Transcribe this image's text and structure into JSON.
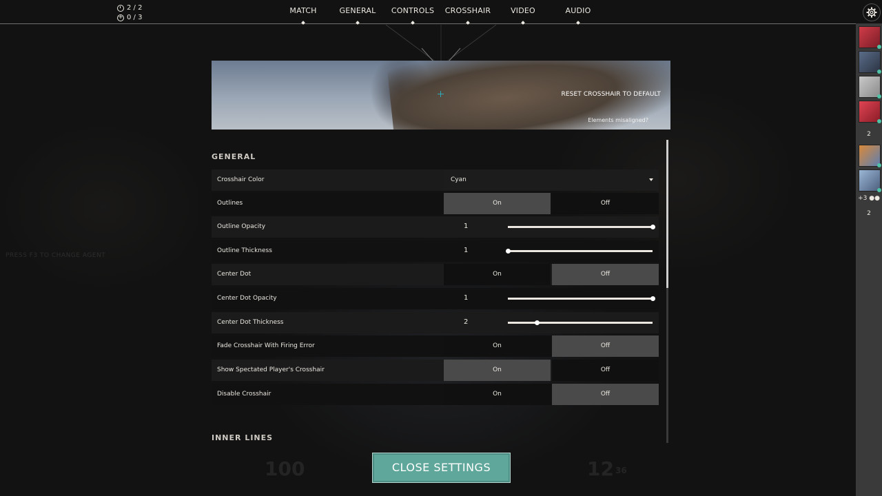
{
  "hud": {
    "rounds": "2 / 2",
    "credits": "0 / 3",
    "health": "100",
    "ammo": "12",
    "reserve": "36",
    "agent_hint": "PRESS F3 TO CHANGE AGENT"
  },
  "tabs": [
    {
      "label": "MATCH"
    },
    {
      "label": "GENERAL"
    },
    {
      "label": "CONTROLS"
    },
    {
      "label": "CROSSHAIR"
    },
    {
      "label": "VIDEO"
    },
    {
      "label": "AUDIO"
    }
  ],
  "preview": {
    "reset_label": "RESET CROSSHAIR TO DEFAULT",
    "misaligned_label": "Elements misaligned?"
  },
  "general": {
    "title": "GENERAL",
    "crosshair_color": {
      "label": "Crosshair Color",
      "value": "Cyan"
    },
    "outlines": {
      "label": "Outlines",
      "on": "On",
      "off": "Off",
      "selected": "on"
    },
    "outline_opacity": {
      "label": "Outline Opacity",
      "value": "1",
      "fraction": 1.0
    },
    "outline_thickness": {
      "label": "Outline Thickness",
      "value": "1",
      "fraction": 0.0
    },
    "center_dot": {
      "label": "Center Dot",
      "on": "On",
      "off": "Off",
      "selected": "off"
    },
    "center_dot_opacity": {
      "label": "Center Dot Opacity",
      "value": "1",
      "fraction": 1.0
    },
    "center_dot_thickness": {
      "label": "Center Dot Thickness",
      "value": "2",
      "fraction": 0.2
    },
    "fade_crosshair": {
      "label": "Fade Crosshair With Firing Error",
      "on": "On",
      "off": "Off",
      "selected": "off"
    },
    "show_spectated": {
      "label": "Show Spectated Player's Crosshair",
      "on": "On",
      "off": "Off",
      "selected": "on"
    },
    "disable_crosshair": {
      "label": "Disable Crosshair",
      "on": "On",
      "off": "Off",
      "selected": "off"
    }
  },
  "inner_lines": {
    "title": "INNER LINES"
  },
  "roster": {
    "team_count": "2",
    "extra_players": "+3",
    "enemy_count": "2"
  },
  "close_label": "CLOSE SETTINGS",
  "colors": {
    "accent": "#5fa79a",
    "crosshair": "#2ea9b8",
    "toggle_selected": "#4a4a4a",
    "online_status": "#4ec3a6"
  },
  "icons": {
    "settings": "gear-icon",
    "rounds": "clock-icon",
    "credits": "plus-circle-icon",
    "dropdown": "chevron-down-icon",
    "party": "people-icon"
  }
}
